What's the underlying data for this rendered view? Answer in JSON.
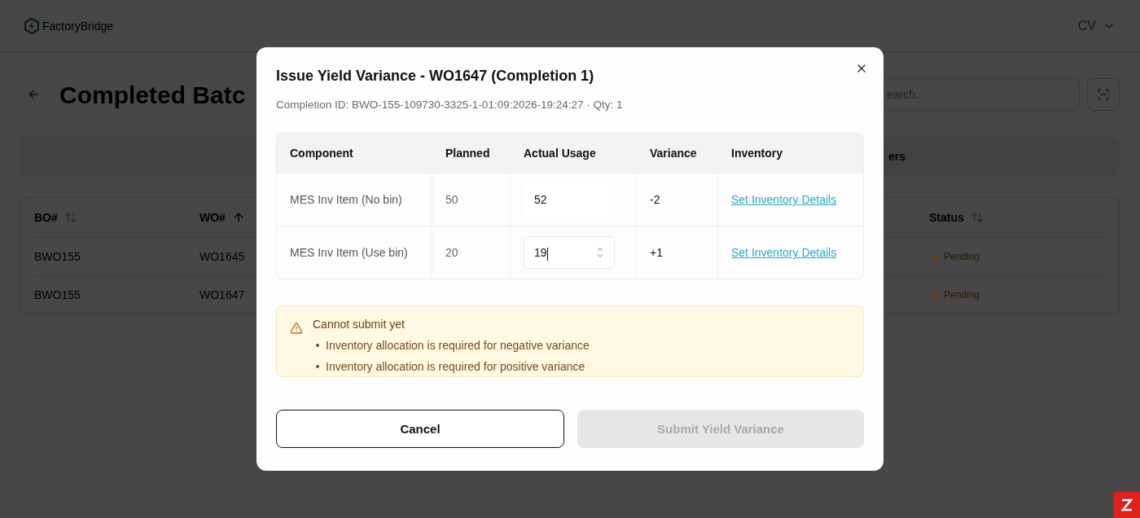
{
  "header": {
    "logo": "FactoryBridge",
    "user": "CV"
  },
  "page": {
    "title": "Completed Batc",
    "search": {
      "placeholder": "earch.."
    },
    "tab": "ers"
  },
  "table": {
    "columns": [
      {
        "label": "BO#",
        "sorted_ascending": false
      },
      {
        "label": "WO#",
        "sorted_ascending": true
      },
      {
        "label": "Status",
        "sorted_ascending": false
      }
    ],
    "rows": [
      {
        "bo": "BWO155",
        "wo": "WO1645",
        "status": "Pending"
      },
      {
        "bo": "BWO155",
        "wo": "WO1647",
        "status": "Pending"
      }
    ]
  },
  "dialog": {
    "title": "Issue Yield Variance - WO1647 (Completion 1)",
    "subtitle": "Completion ID: BWO-155-109730-3325-1-01:09:2026-19:24:27 · Qty: 1",
    "columns": [
      "Component",
      "Planned",
      "Actual Usage",
      "Variance",
      "Inventory"
    ],
    "rows": [
      {
        "component": "MES Inv Item (No bin)",
        "planned": "50",
        "actual": "52",
        "focused": false,
        "variance": "-2",
        "link": "Set Inventory Details"
      },
      {
        "component": "MES Inv Item (Use bin)",
        "planned": "20",
        "actual": "19",
        "focused": true,
        "variance": "+1",
        "link": "Set Inventory Details"
      }
    ],
    "alert": {
      "title": "Cannot submit yet",
      "items": [
        "Inventory allocation is required for negative variance",
        "Inventory allocation is required for positive variance"
      ]
    },
    "cancel": "Cancel",
    "submit": {
      "label": "Submit Yield Variance",
      "disabled": true
    }
  }
}
